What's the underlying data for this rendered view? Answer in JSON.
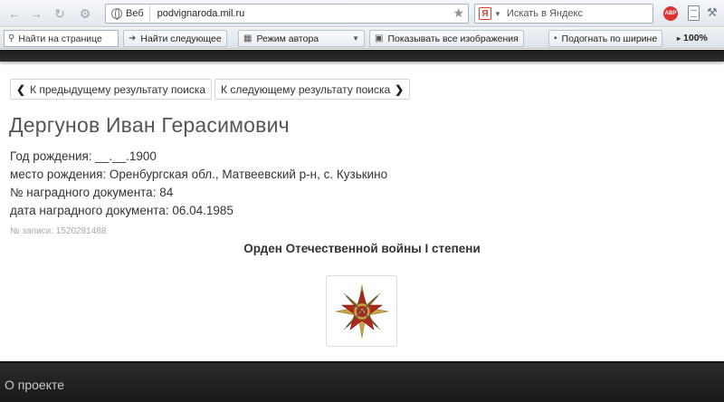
{
  "browser": {
    "url_chip": "Веб",
    "url": "podvignaroda.mil.ru",
    "search_engine_badge": "Я",
    "search_placeholder": "Искать в Яндекс",
    "abp_label": "ABP"
  },
  "toolbar": {
    "find_placeholder": "Найти на странице",
    "find_next": "Найти следующее",
    "author_mode": "Режим автора",
    "show_images": "Показывать все изображения",
    "fit_width": "Подогнать по ширине",
    "zoom": "100%"
  },
  "page": {
    "prev_result": "К предыдущему результату поиска",
    "next_result": "К следующему результату поиска",
    "person_name": "Дергунов Иван Герасимович",
    "info": [
      "Год рождения: __.__.1900",
      "место рождения: Оренбургская обл., Матвеевский р-н, с. Кузькино",
      "№ наградного документа: 84",
      "дата наградного документа: 06.04.1985"
    ],
    "record_number": "№ записи: 1520281488",
    "award_title": "Орден Отечественной войны I степени"
  },
  "footer": {
    "about": "О проекте"
  },
  "colors": {
    "medal_red": "#b3261e",
    "medal_gold": "#c9a448",
    "footer_bg": "#222222"
  }
}
